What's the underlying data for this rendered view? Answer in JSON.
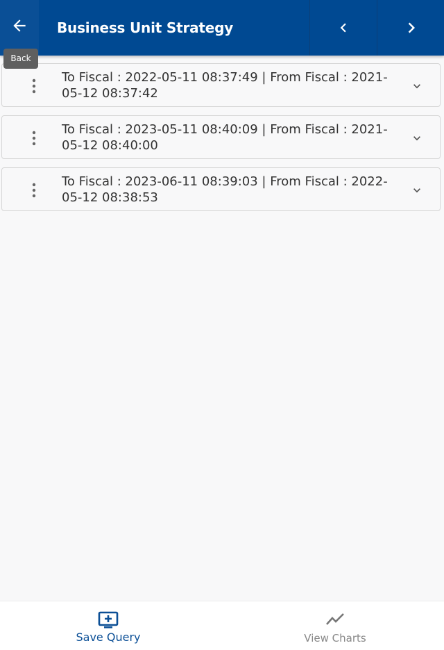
{
  "header": {
    "title": "Business Unit Strategy",
    "back_tooltip": "Back",
    "back_icon": "arrow-left-icon",
    "prev_icon": "chevron-left-icon",
    "next_icon": "chevron-right-icon"
  },
  "records": [
    {
      "text": "To Fiscal : 2022-05-11 08:37:49 | From Fiscal : 2021-05-12 08:37:42"
    },
    {
      "text": "To Fiscal : 2023-05-11 08:40:09 | From Fiscal : 2021-05-12 08:40:00"
    },
    {
      "text": "To Fiscal : 2023-06-11 08:39:03 | From Fiscal : 2022-05-12 08:38:53"
    }
  ],
  "footer": {
    "save_query_label": "Save Query",
    "view_charts_label": "View Charts",
    "active_tab": "Save Query"
  },
  "colors": {
    "primary": "#004992",
    "active_tab": "#0b4f96",
    "inactive_tab": "#888888",
    "tooltip_bg": "#5f5f5f"
  }
}
